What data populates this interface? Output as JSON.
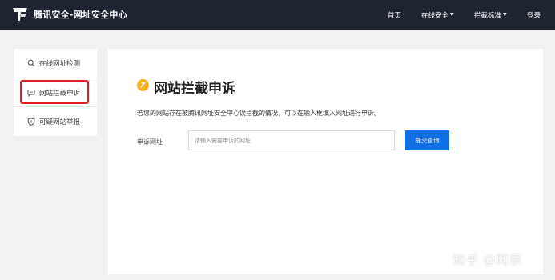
{
  "header": {
    "brand": "腾讯安全-网址安全中心",
    "nav": [
      {
        "label": "首页",
        "has_dropdown": false
      },
      {
        "label": "在线安全",
        "has_dropdown": true
      },
      {
        "label": "拦截标准",
        "has_dropdown": true
      },
      {
        "label": "登录",
        "has_dropdown": false
      }
    ]
  },
  "sidebar": {
    "items": [
      {
        "label": "在线网址检测",
        "icon": "search-icon"
      },
      {
        "label": "网站拦截申诉",
        "icon": "chat-icon"
      },
      {
        "label": "可疑网站举报",
        "icon": "shield-icon"
      }
    ]
  },
  "main": {
    "title": "网站拦截申诉",
    "description": "若您的网站存在被腾讯网址安全中心误拦截的情况，可以在输入框填入网址进行申诉。",
    "field_label": "申诉网址",
    "input_placeholder": "请输入需要申诉的网址",
    "input_value": "",
    "submit_label": "提交查询"
  },
  "watermark": "知乎 @阿季",
  "colors": {
    "header_bg": "#1f2431",
    "accent_blue": "#0f6fe6",
    "highlight_red": "#e02020",
    "title_icon": "#f5b21e"
  }
}
